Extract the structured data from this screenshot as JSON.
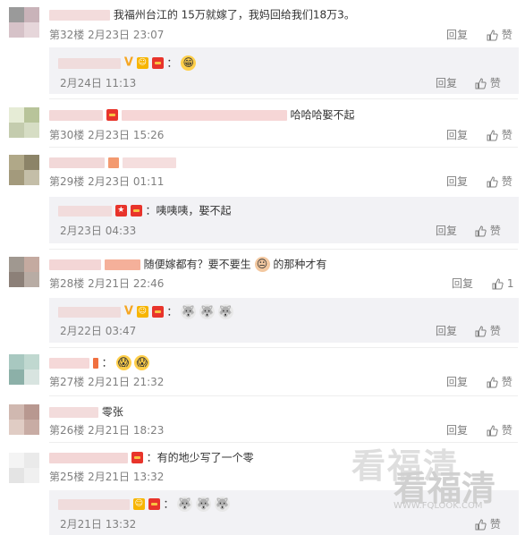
{
  "actions": {
    "reply": "回复",
    "like": "赞",
    "like_count_28": "1"
  },
  "comments": [
    {
      "text": "我福州台江的 15万就嫁了，我妈回给我们18万3。",
      "floor": "第32楼",
      "time": "2月23日 23:07"
    },
    {
      "text": "哈哈哈娶不起",
      "floor": "第30楼",
      "time": "2月23日 15:26"
    },
    {
      "text": "",
      "floor": "第29楼",
      "time": "2月23日 01:11"
    },
    {
      "text_a": "随便嫁都有？要不要生",
      "text_b": "的那种才有",
      "floor": "第28楼",
      "time": "2月21日 22:46"
    },
    {
      "text": "：",
      "floor": "第27楼",
      "time": "2月21日 21:32"
    },
    {
      "text": "零张",
      "floor": "第26楼",
      "time": "2月21日 18:23"
    },
    {
      "text": "：有的地少写了一个零",
      "floor": "第25楼",
      "time": "2月21日 13:32"
    }
  ],
  "replies": [
    {
      "text": "：",
      "time": "2月24日 11:13"
    },
    {
      "text": "：咦咦咦，娶不起",
      "time": "2月23日 04:33"
    },
    {
      "text": "：",
      "time": "2月22日 03:47"
    },
    {
      "text": "：",
      "time": "2月21日 13:32"
    }
  ],
  "watermark": {
    "line1": "看福清",
    "line2": "看福清",
    "url": "WWW.FQLOOK.COM"
  }
}
